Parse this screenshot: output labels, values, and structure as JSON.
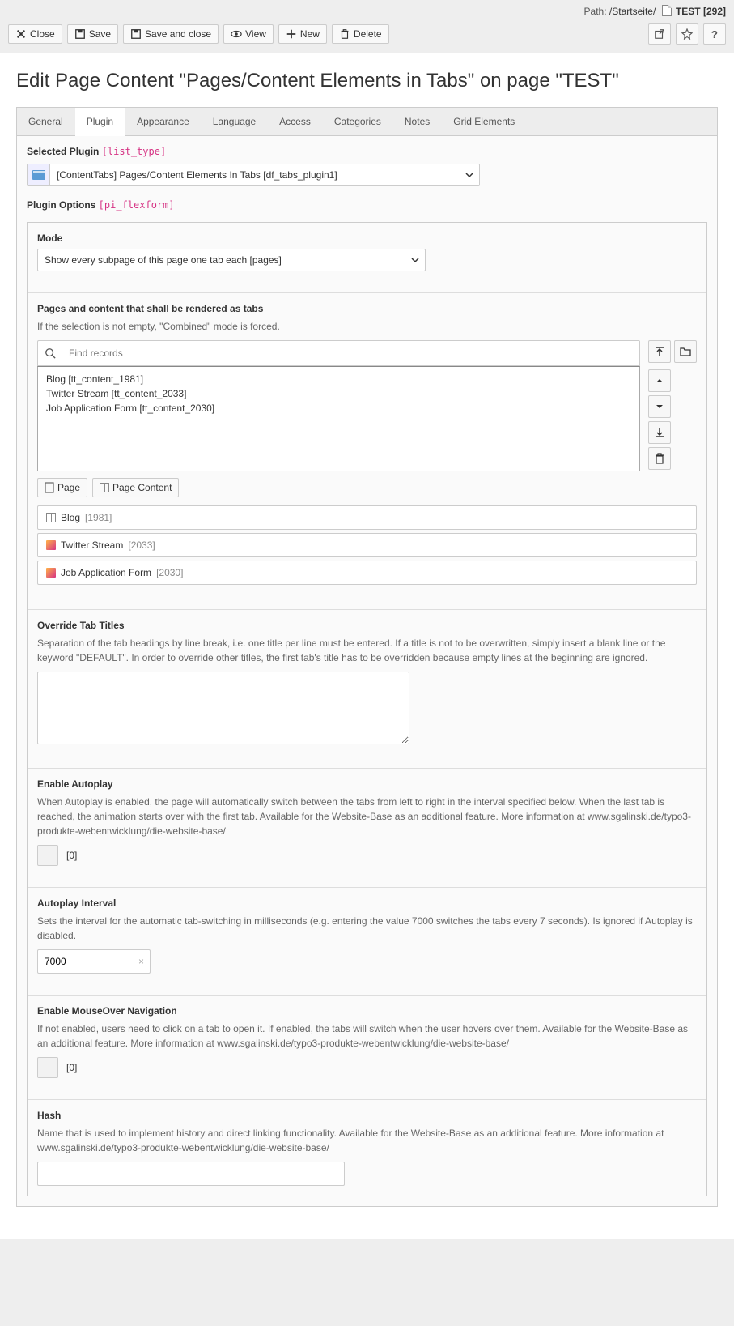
{
  "path": {
    "label": "Path:",
    "breadcrumb": "/Startseite/",
    "page": "TEST",
    "uid": "[292]"
  },
  "toolbar": {
    "close": "Close",
    "save": "Save",
    "save_close": "Save and close",
    "view": "View",
    "new": "New",
    "delete": "Delete"
  },
  "title": "Edit Page Content \"Pages/Content Elements in Tabs\" on page \"TEST\"",
  "tabs": [
    "General",
    "Plugin",
    "Appearance",
    "Language",
    "Access",
    "Categories",
    "Notes",
    "Grid Elements"
  ],
  "active_tab": 1,
  "plugin": {
    "section_label": "Selected Plugin",
    "section_code": "[list_type]",
    "selected": "[ContentTabs] Pages/Content Elements In Tabs [df_tabs_plugin1]"
  },
  "options": {
    "section_label": "Plugin Options",
    "section_code": "[pi_flexform]",
    "mode": {
      "label": "Mode",
      "value": "Show every subpage of this page one tab each [pages]"
    },
    "records": {
      "label": "Pages and content that shall be rendered as tabs",
      "help": "If the selection is not empty, \"Combined\" mode is forced.",
      "placeholder": "Find records",
      "items": [
        "Blog [tt_content_1981]",
        "Twitter Stream [tt_content_2033]",
        "Job Application Form [tt_content_2030]"
      ],
      "btn_page": "Page",
      "btn_content": "Page Content",
      "results": [
        {
          "type": "grid",
          "title": "Blog",
          "uid": "[1981]"
        },
        {
          "type": "cube",
          "title": "Twitter Stream",
          "uid": "[2033]"
        },
        {
          "type": "cube",
          "title": "Job Application Form",
          "uid": "[2030]"
        }
      ]
    },
    "override": {
      "label": "Override Tab Titles",
      "help": "Separation of the tab headings by line break, i.e. one title per line must be entered. If a title is not to be overwritten, simply insert a blank line or the keyword \"DEFAULT\". In order to override other titles, the first tab's title has to be overridden because empty lines at the beginning are ignored.",
      "value": ""
    },
    "autoplay": {
      "label": "Enable Autoplay",
      "help": "When Autoplay is enabled, the page will automatically switch between the tabs from left to right in the interval specified below. When the last tab is reached, the animation starts over with the first tab. Available for the Website-Base as an additional feature. More information at www.sgalinski.de/typo3-produkte-webentwicklung/die-website-base/",
      "value_label": "[0]"
    },
    "interval": {
      "label": "Autoplay Interval",
      "help": "Sets the interval for the automatic tab-switching in milliseconds (e.g. entering the value 7000 switches the tabs every 7 seconds). Is ignored if Autoplay is disabled.",
      "value": "7000"
    },
    "mouseover": {
      "label": "Enable MouseOver Navigation",
      "help": "If not enabled, users need to click on a tab to open it. If enabled, the tabs will switch when the user hovers over them. Available for the Website-Base as an additional feature. More information at www.sgalinski.de/typo3-produkte-webentwicklung/die-website-base/",
      "value_label": "[0]"
    },
    "hash": {
      "label": "Hash",
      "help": "Name that is used to implement history and direct linking functionality. Available for the Website-Base as an additional feature. More information at www.sgalinski.de/typo3-produkte-webentwicklung/die-website-base/",
      "value": ""
    }
  }
}
